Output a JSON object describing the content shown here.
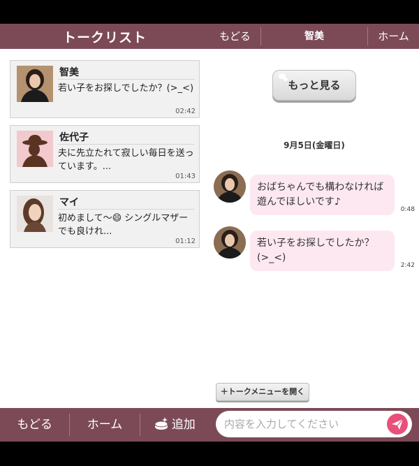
{
  "list_panel": {
    "title": "トークリスト",
    "items": [
      {
        "name": "智美",
        "preview": "若い子をお探しでしたか？(>_<)",
        "time": "02:42",
        "avatar": "woman-photo-1"
      },
      {
        "name": "佐代子",
        "preview": "夫に先立たれて寂しい毎日を送っています。...",
        "time": "01:43",
        "avatar": "lady-silhouette-icon"
      },
      {
        "name": "マイ",
        "preview": "初めまして〜😄 シングルマザーでも良けれ...",
        "time": "01:12",
        "avatar": "woman-photo-2"
      }
    ],
    "footer": {
      "back": "もどる",
      "home": "ホーム",
      "add": "追加"
    }
  },
  "chat_panel": {
    "back": "もどる",
    "title": "智美",
    "home": "ホーム",
    "more_button": "もっと見る",
    "date": "9月5日(金曜日)",
    "messages": [
      {
        "text": "おばちゃんでも構わなければ遊んでほしいです♪",
        "time": "0:48"
      },
      {
        "text": "若い子をお探しでしたか？(>_<)",
        "time": "2:42"
      }
    ],
    "menu_button": "＋トークメニューを開く",
    "input_placeholder": "内容を入力してください"
  },
  "colors": {
    "bar": "#7c4a57",
    "bubble": "#fde8f1",
    "send": "#e94f7a"
  }
}
